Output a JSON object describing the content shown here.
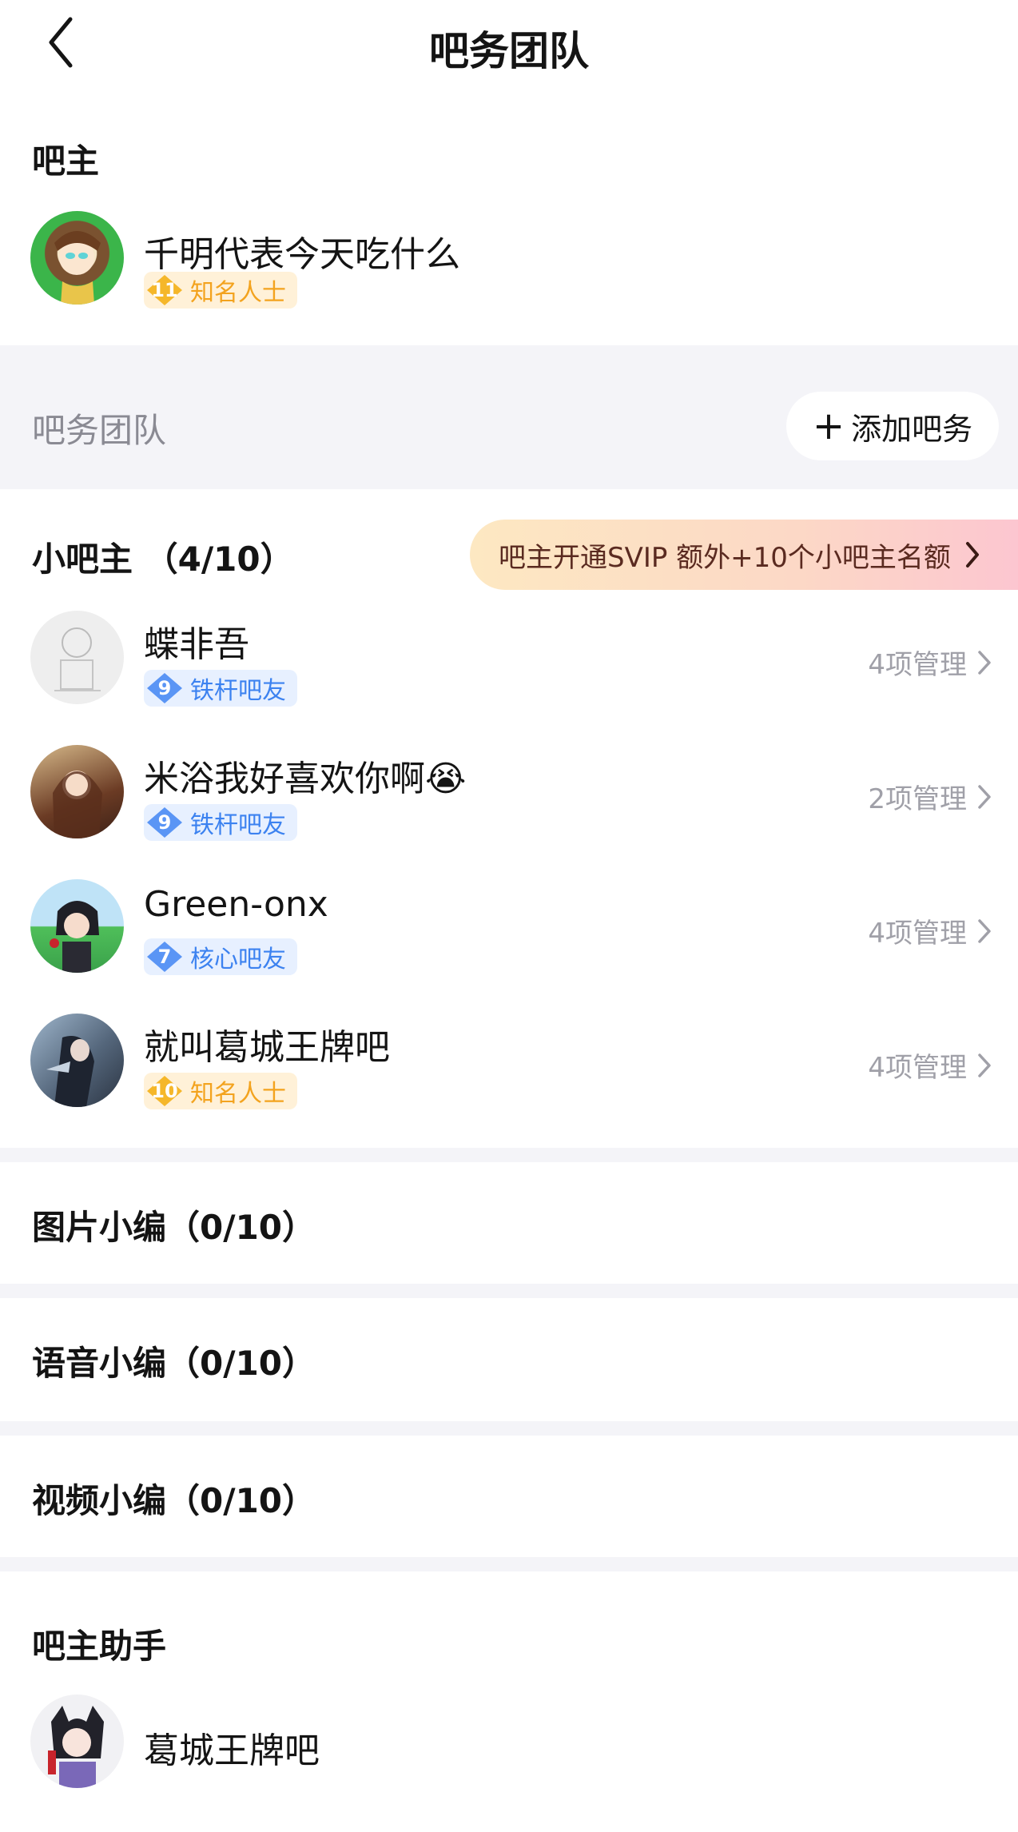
{
  "nav": {
    "title": "吧务团队",
    "back_icon": "chevron-left-icon"
  },
  "owner_section": {
    "title": "吧主",
    "member": {
      "name": "千明代表今天吃什么",
      "level": "11",
      "badge": "知名人士",
      "badge_color": "#f3a31e"
    }
  },
  "team": {
    "label": "吧务团队",
    "add_button": "添加吧务"
  },
  "sub_owners": {
    "title": "小吧主 （4/10）",
    "promo": "吧主开通SVIP 额外+10个小吧主名额",
    "members": [
      {
        "name": "蝶非吾",
        "level": "9",
        "badge": "铁杆吧友",
        "manage": "4项管理"
      },
      {
        "name": "米浴我好喜欢你啊😭",
        "level": "9",
        "badge": "铁杆吧友",
        "manage": "2项管理"
      },
      {
        "name": "Green-onx",
        "level": "7",
        "badge": "核心吧友",
        "manage": "4项管理"
      },
      {
        "name": "就叫葛城王牌吧",
        "level": "10",
        "badge": "知名人士",
        "manage": "4项管理"
      }
    ]
  },
  "editor_sections": [
    {
      "title": "图片小编（0/10）"
    },
    {
      "title": "语音小编（0/10）"
    },
    {
      "title": "视频小编（0/10）"
    }
  ],
  "assistant_section": {
    "title": "吧主助手",
    "member": {
      "name": "葛城王牌吧"
    }
  },
  "colors": {
    "band_bg": "#f4f4f8",
    "blue_badge": "#3c82f0",
    "gold_badge": "#f3a31e",
    "muted_text": "#a0a0a8"
  }
}
